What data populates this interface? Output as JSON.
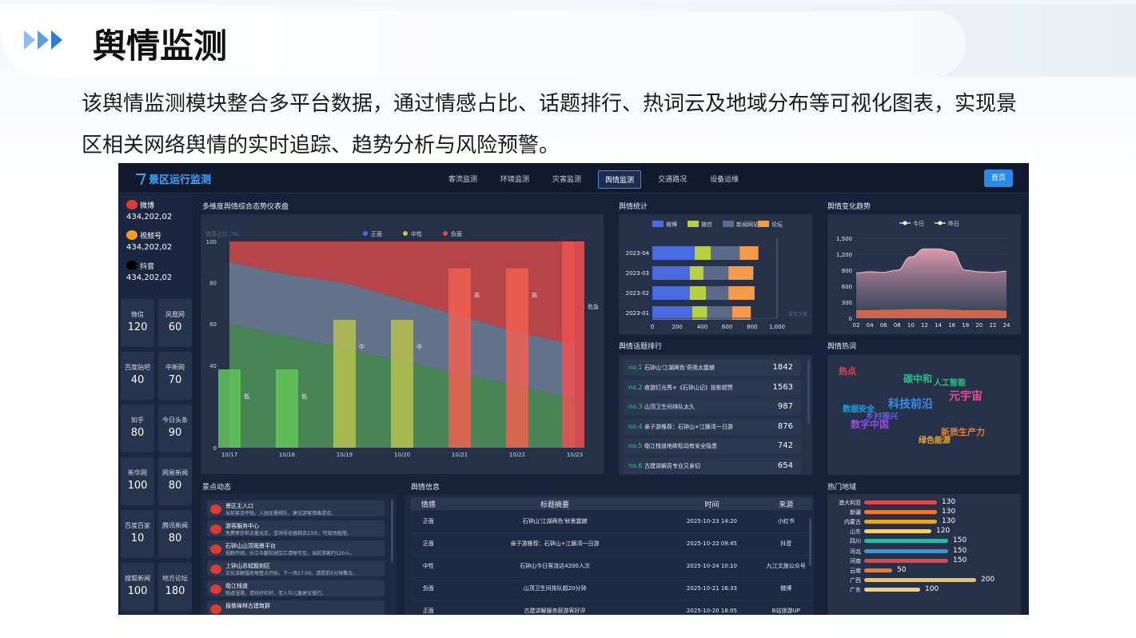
{
  "slide": {
    "title": "舆情监测",
    "description": "该舆情监测模块整合多平台数据，通过情感占比、话题排行、热词云及地域分布等可视化图表，实现景区相关网络舆情的实时追踪、趋势分析与风险预警。"
  },
  "dashboard": {
    "app_title": "景区运行监测",
    "nav_tabs": [
      "客流监测",
      "环境监测",
      "灾害监测",
      "舆情监测",
      "交通路况",
      "设备运维"
    ],
    "active_tab": "舆情监测",
    "home_label": "首页",
    "socials": [
      {
        "name": "微博",
        "value": "434,202,02",
        "icon": "weibo-icon",
        "color": "#e03b2e"
      },
      {
        "name": "视频号",
        "value": "434,202,02",
        "icon": "video-channel-icon",
        "color": "#f0a020"
      },
      {
        "name": "抖音",
        "value": "434,202,02",
        "icon": "douyin-icon",
        "color": "#000000"
      }
    ],
    "platform_cards": [
      {
        "label": "微信",
        "value": "120"
      },
      {
        "label": "凤凰网",
        "value": "60"
      },
      {
        "label": "百度贴吧",
        "value": "40"
      },
      {
        "label": "中新网",
        "value": "70"
      },
      {
        "label": "知乎",
        "value": "80"
      },
      {
        "label": "今日头条",
        "value": "90"
      },
      {
        "label": "新华网",
        "value": "100"
      },
      {
        "label": "网易新闻",
        "value": "80"
      },
      {
        "label": "百度百家",
        "value": "10"
      },
      {
        "label": "腾讯新闻",
        "value": "80"
      },
      {
        "label": "搜狐新闻",
        "value": "100"
      },
      {
        "label": "地方论坛",
        "value": "180"
      }
    ],
    "panels": {
      "sentiment_dashboard": "多维度舆情综合态势仪表盘",
      "stats": "舆情统计",
      "trend": "舆情变化趋势",
      "topic_rank": "舆情话题排行",
      "hotwords": "舆情热词",
      "scenic_news": "景点动态",
      "info": "舆情信息",
      "hot_regions": "热门地域"
    },
    "topics": [
      {
        "rank": "no.1",
        "title": "石钟山'江湖两色'奇观太震撼",
        "value": "1842"
      },
      {
        "rank": "no.2",
        "title": "夜游灯光秀+《石钟山记》投影超赞",
        "value": "1563"
      },
      {
        "rank": "no.3",
        "title": "山顶卫生间排队太久",
        "value": "987"
      },
      {
        "rank": "no.4",
        "title": "亲子游推荐：石钟山+江豚湾一日游",
        "value": "876"
      },
      {
        "rank": "no.5",
        "title": "临江栈道地砖松动有安全隐患",
        "value": "742"
      },
      {
        "rank": "no.6",
        "title": "古建讲解员专业又亲切",
        "value": "654"
      }
    ],
    "hotwords": [
      {
        "text": "热点",
        "color": "#e04848"
      },
      {
        "text": "碳中和",
        "color": "#2fbf8a"
      },
      {
        "text": "人工智能",
        "color": "#2fbf8a"
      },
      {
        "text": "元宇宙",
        "color": "#e8489a"
      },
      {
        "text": "科技前沿",
        "color": "#3a8eea"
      },
      {
        "text": "数据安全",
        "color": "#1fa0d6"
      },
      {
        "text": "乡村振兴",
        "color": "#6a5af0"
      },
      {
        "text": "数字中国",
        "color": "#9a48e8"
      },
      {
        "text": "新质生产力",
        "color": "#f07a28"
      },
      {
        "text": "绿色能源",
        "color": "#e8a820"
      }
    ],
    "scenic_news": [
      {
        "title": "景区主入口",
        "desc": "当前客流平稳，入园无需排队，建议游客错峰游览。"
      },
      {
        "title": "游客服务中心",
        "desc": "免费寄存柜余量充足，咨询导览器剩余23台，可现场租借。"
      },
      {
        "title": "石钟山山顶观景平台",
        "desc": "视野开阔，长江与鄱阳湖交汇清晰可见，当前游客约120人。"
      },
      {
        "title": "上钟山苏轼题刻区",
        "desc": "文化讲解服务每整点开始，下一场17:00，请提前5分钟集合。"
      },
      {
        "title": "临江栈道",
        "desc": "栈道湿滑，请扶好栏杆，老人与儿童建议慢行。"
      },
      {
        "title": "报慈禅林古建筑群",
        "desc": ""
      }
    ],
    "info_table": {
      "headers": [
        "情感",
        "标题摘要",
        "时间",
        "来源"
      ],
      "rows": [
        [
          "正面",
          "石钟山'江湖两色'秋景震撼",
          "2025-10-23 14:20",
          "小红书"
        ],
        [
          "正面",
          "亲子游推荐：石钟山+江豚湾一日游",
          "2025-10-22 09:45",
          "抖音"
        ],
        [
          "中性",
          "石钟山今日客流达4200人次",
          "2025-10-24 10:10",
          "九江文旅公众号"
        ],
        [
          "负面",
          "山顶卫生间排队超20分钟",
          "2025-10-21 16:33",
          "微博"
        ],
        [
          "正面",
          "古建讲解服务获游客好评",
          "2025-10-20 18:05",
          "B站旅游UP"
        ]
      ]
    },
    "regions": [
      {
        "name": "澳大利亚",
        "value": 130,
        "color": "#e04848"
      },
      {
        "name": "新疆",
        "value": 130,
        "color": "#f07a28"
      },
      {
        "name": "内蒙古",
        "value": 130,
        "color": "#e8a820"
      },
      {
        "name": "山东",
        "value": 120,
        "color": "#f0d070"
      },
      {
        "name": "四川",
        "value": 150,
        "color": "#2fb8a8"
      },
      {
        "name": "河北",
        "value": 150,
        "color": "#3a9ad6"
      },
      {
        "name": "河南",
        "value": 150,
        "color": "#e04848"
      },
      {
        "name": "云南",
        "value": 50,
        "color": "#f07a28"
      },
      {
        "name": "广西",
        "value": 200,
        "color": "#f0c060"
      },
      {
        "name": "广东",
        "value": 100,
        "color": "#f0d070"
      }
    ]
  },
  "chart_data": [
    {
      "type": "bar",
      "id": "sentiment",
      "categories": [
        "10/17",
        "10/18",
        "10/19",
        "10/20",
        "10/21",
        "10/22",
        "10/23"
      ],
      "ylabel": "情感占比 (%)",
      "ylim": [
        0,
        100
      ],
      "legend": [
        "正面",
        "中性",
        "负面"
      ],
      "legend_colors": [
        "#4a6ae0",
        "#b8d040",
        "#e04848"
      ],
      "bars": [
        {
          "value": 38,
          "label": "低",
          "color": "#62c45c"
        },
        {
          "value": 38,
          "label": "低",
          "color": "#62c45c"
        },
        {
          "value": 62,
          "label": "中",
          "color": "#b8c050"
        },
        {
          "value": 62,
          "label": "中",
          "color": "#b8c050"
        },
        {
          "value": 87,
          "label": "高",
          "color": "#f06050"
        },
        {
          "value": 87,
          "label": "高",
          "color": "#f06050"
        },
        {
          "value": 100,
          "label": "",
          "color": "#f05050"
        }
      ],
      "area_positive": [
        60,
        54,
        48,
        42,
        36,
        30,
        24
      ],
      "area_neutral": [
        90,
        84,
        80,
        72,
        64,
        56,
        50
      ],
      "area_negative": [
        100,
        100,
        100,
        100,
        100,
        100,
        100
      ],
      "right_axis_label": "危急"
    },
    {
      "type": "bar",
      "id": "stats",
      "orientation": "horizontal",
      "stacked": true,
      "categories": [
        "2023-04",
        "2023-03",
        "2023-02",
        "2023-01"
      ],
      "xlim": [
        0,
        1000
      ],
      "x_ticks": [
        "0",
        "200",
        "400",
        "600",
        "800",
        "1,000"
      ],
      "xlabel": "提及次数",
      "series": [
        {
          "name": "微博",
          "color": "#4a6ae0",
          "values": [
            340,
            300,
            300,
            320
          ]
        },
        {
          "name": "微信",
          "color": "#b8d040",
          "values": [
            130,
            110,
            130,
            120
          ]
        },
        {
          "name": "新闻网站",
          "color": "#5a6a88",
          "values": [
            230,
            200,
            180,
            200
          ]
        },
        {
          "name": "论坛",
          "color": "#f59a48",
          "values": [
            150,
            200,
            210,
            150
          ]
        }
      ]
    },
    {
      "type": "area",
      "id": "trend",
      "x": [
        "02",
        "04",
        "06",
        "08",
        "10",
        "12",
        "14",
        "16",
        "18",
        "20",
        "22",
        "24"
      ],
      "ylim": [
        0,
        1500
      ],
      "y_ticks": [
        "1,500",
        "1,200",
        "900",
        "600",
        "300",
        "0"
      ],
      "series": [
        {
          "name": "今日",
          "color": "#e8a0b0",
          "values": [
            850,
            870,
            860,
            900,
            1150,
            1300,
            1300,
            1250,
            900,
            870,
            860,
            880
          ]
        },
        {
          "name": "昨日",
          "color": "#f07a48",
          "values": [
            150,
            150,
            160,
            160,
            170,
            170,
            170,
            160,
            150,
            150,
            150,
            140
          ]
        }
      ]
    }
  ]
}
